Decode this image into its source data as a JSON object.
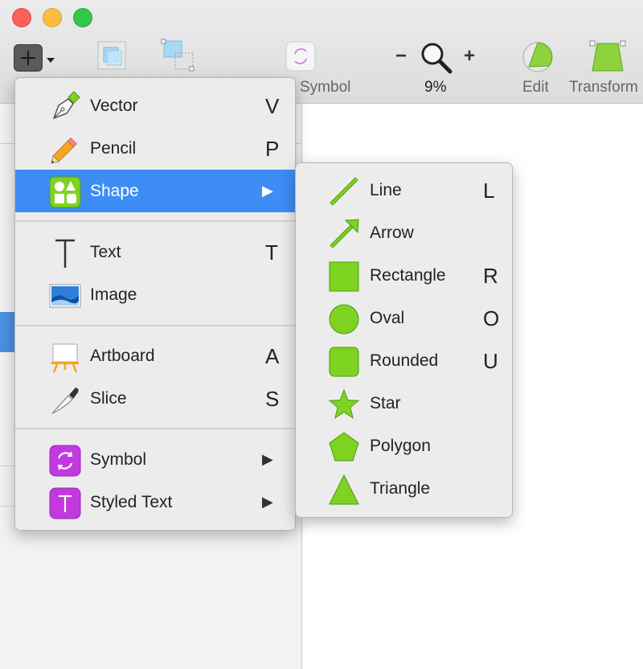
{
  "toolbar": {
    "symbol_label": "Symbol",
    "zoom_minus": "−",
    "zoom_plus": "+",
    "zoom_value": "9%",
    "edit_label": "Edit",
    "transform_label": "Transform"
  },
  "insert_menu": {
    "items": [
      {
        "label": "Vector",
        "shortcut": "V",
        "icon": "pen-icon"
      },
      {
        "label": "Pencil",
        "shortcut": "P",
        "icon": "pencil-icon"
      },
      {
        "label": "Shape",
        "submenu_arrow": "▶",
        "icon": "shapes-icon",
        "highlighted": true
      },
      {
        "label": "Text",
        "shortcut": "T",
        "icon": "text-icon"
      },
      {
        "label": "Image",
        "icon": "image-icon"
      },
      {
        "label": "Artboard",
        "shortcut": "A",
        "icon": "artboard-easel-icon"
      },
      {
        "label": "Slice",
        "shortcut": "S",
        "icon": "knife-icon"
      },
      {
        "label": "Symbol",
        "submenu_arrow": "▶",
        "icon": "symbol-icon"
      },
      {
        "label": "Styled Text",
        "submenu_arrow": "▶",
        "icon": "styled-text-icon"
      }
    ]
  },
  "shape_menu": {
    "items": [
      {
        "label": "Line",
        "shortcut": "L",
        "icon": "line-icon"
      },
      {
        "label": "Arrow",
        "shortcut": "",
        "icon": "arrow-icon"
      },
      {
        "label": "Rectangle",
        "shortcut": "R",
        "icon": "rectangle-icon"
      },
      {
        "label": "Oval",
        "shortcut": "O",
        "icon": "oval-icon"
      },
      {
        "label": "Rounded",
        "shortcut": "U",
        "icon": "rounded-rect-icon"
      },
      {
        "label": "Star",
        "shortcut": "",
        "icon": "star-icon"
      },
      {
        "label": "Polygon",
        "shortcut": "",
        "icon": "polygon-icon"
      },
      {
        "label": "Triangle",
        "shortcut": "",
        "icon": "triangle-icon"
      }
    ]
  },
  "colors": {
    "highlight": "#3d8df5",
    "shape_green": "#7ed321",
    "symbol_purple": "#c239e0"
  }
}
